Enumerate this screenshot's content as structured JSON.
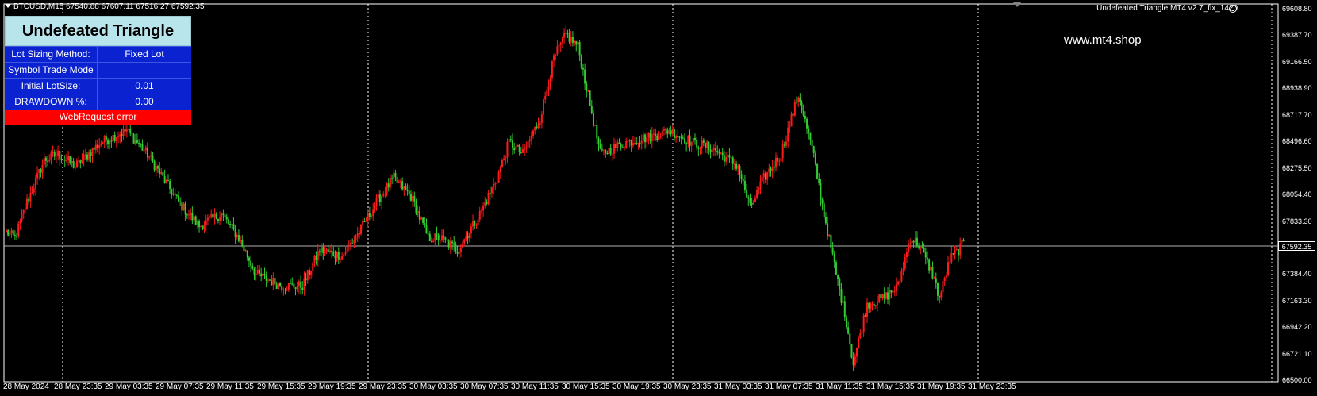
{
  "header": {
    "symbol_info": "BTCUSD,M15  67540.88 67607.11 67516.27 67592.35"
  },
  "ea_label": "Undefeated Triangle MT4 v2.7_fix_1420",
  "watermark": "www.mt4.shop",
  "panel": {
    "title": "Undefeated Triangle",
    "rows": [
      {
        "label": "Lot Sizing Method:",
        "value": "Fixed Lot"
      },
      {
        "label": "Symbol Trade Mode",
        "value": ""
      },
      {
        "label": "Initial LotSize:",
        "value": "0.01"
      },
      {
        "label": "DRAWDOWN %:",
        "value": "0.00"
      }
    ],
    "error": "WebRequest error"
  },
  "price_axis": [
    "69608.80",
    "69387.70",
    "69166.50",
    "68938.90",
    "68717.70",
    "68496.60",
    "68275.50",
    "68054.40",
    "67833.30",
    "67592.35",
    "67384.40",
    "67163.30",
    "66942.20",
    "66721.10",
    "66500.00"
  ],
  "current_price": "67592.35",
  "time_axis": [
    "28 May 2024",
    "28 May 23:35",
    "29 May 03:35",
    "29 May 07:35",
    "29 May 11:35",
    "29 May 15:35",
    "29 May 19:35",
    "29 May 23:35",
    "30 May 03:35",
    "30 May 07:35",
    "30 May 11:35",
    "30 May 15:35",
    "30 May 19:35",
    "30 May 23:35",
    "31 May 03:35",
    "31 May 07:35",
    "31 May 11:35",
    "31 May 15:35",
    "31 May 19:35",
    "31 May 23:35"
  ],
  "colors": {
    "bull": "#ff1a1a",
    "bear": "#33cc33",
    "background": "#000000",
    "grid": "#ffffff",
    "panel_header": "#b8e4ec",
    "panel_body": "#0a22cf",
    "error": "#ff0000"
  },
  "chart_data": {
    "type": "candlestick",
    "symbol": "BTCUSD",
    "timeframe": "M15",
    "ylim": [
      66500.0,
      69608.8
    ],
    "anchors": [
      [
        0,
        67750
      ],
      [
        5,
        67700
      ],
      [
        12,
        68000
      ],
      [
        22,
        68350
      ],
      [
        30,
        68400
      ],
      [
        40,
        68300
      ],
      [
        55,
        68500
      ],
      [
        70,
        68600
      ],
      [
        82,
        68400
      ],
      [
        100,
        68000
      ],
      [
        112,
        67800
      ],
      [
        125,
        67900
      ],
      [
        135,
        67700
      ],
      [
        145,
        67400
      ],
      [
        160,
        67300
      ],
      [
        172,
        67300
      ],
      [
        182,
        67600
      ],
      [
        195,
        67550
      ],
      [
        205,
        67750
      ],
      [
        215,
        68000
      ],
      [
        225,
        68200
      ],
      [
        235,
        68050
      ],
      [
        245,
        67700
      ],
      [
        252,
        67700
      ],
      [
        262,
        67600
      ],
      [
        275,
        67900
      ],
      [
        285,
        68200
      ],
      [
        292,
        68500
      ],
      [
        300,
        68400
      ],
      [
        310,
        68700
      ],
      [
        318,
        69200
      ],
      [
        325,
        69400
      ],
      [
        332,
        69300
      ],
      [
        345,
        68400
      ],
      [
        360,
        68500
      ],
      [
        375,
        68550
      ],
      [
        385,
        68600
      ],
      [
        398,
        68500
      ],
      [
        410,
        68450
      ],
      [
        425,
        68300
      ],
      [
        432,
        67950
      ],
      [
        440,
        68200
      ],
      [
        450,
        68400
      ],
      [
        460,
        68900
      ],
      [
        468,
        68450
      ],
      [
        475,
        67900
      ],
      [
        482,
        67400
      ],
      [
        488,
        67000
      ],
      [
        492,
        66650
      ],
      [
        500,
        67150
      ],
      [
        510,
        67200
      ],
      [
        518,
        67300
      ],
      [
        525,
        67700
      ],
      [
        530,
        67650
      ],
      [
        538,
        67400
      ],
      [
        542,
        67200
      ],
      [
        548,
        67520
      ],
      [
        556,
        67650
      ]
    ]
  }
}
